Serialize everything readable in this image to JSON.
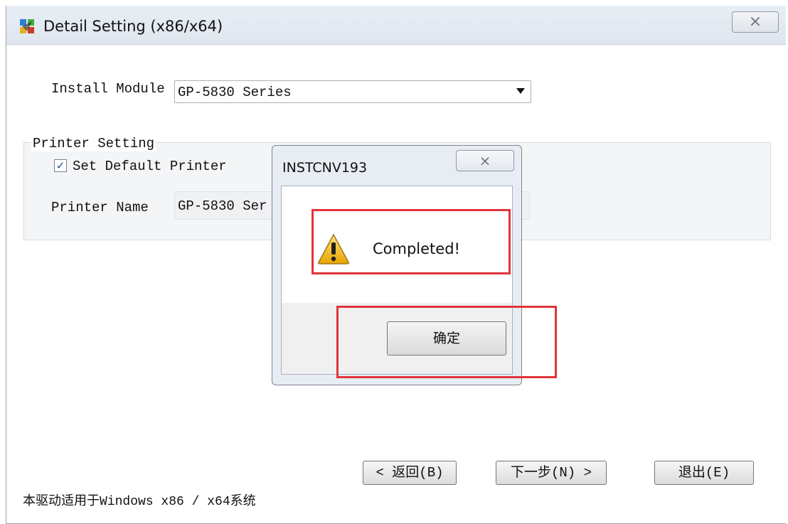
{
  "window": {
    "title": "Detail Setting (x86/x64)",
    "close_glyph": "⨯",
    "icon": "app-installer-icon"
  },
  "install_module": {
    "label": "Install Module",
    "selected": "GP-5830 Series"
  },
  "printer_setting": {
    "group_title": "Printer Setting",
    "set_default_label": "Set Default Printer",
    "set_default_checked": true,
    "printer_name_label": "Printer Name",
    "printer_name_value": "GP-5830 Ser"
  },
  "buttons": {
    "back": "< 返回(B)",
    "next": "下一步(N) >",
    "exit": "退出(E)"
  },
  "footer": "本驱动适用于Windows x86 / x64系统",
  "dialog": {
    "title": "INSTCNV193",
    "close_glyph": "⨯",
    "message": "Completed!",
    "icon": "warning-icon",
    "ok_label": "确定"
  },
  "colors": {
    "highlight": "#e0343a",
    "dialog_frame": "#e8edf3"
  }
}
